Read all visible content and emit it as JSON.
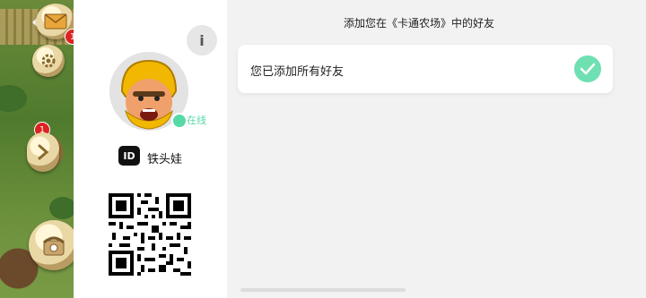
{
  "game_side": {
    "badges": [
      "1",
      "1"
    ]
  },
  "profile": {
    "info_label": "i",
    "online_label": "在线",
    "id_label": "ID",
    "username": "铁头娃",
    "colors": {
      "online": "#57d9a6",
      "accent": "#6ee0b2"
    }
  },
  "friends": {
    "title": "添加您在《卡通农场》中的好友",
    "status_text": "您已添加所有好友"
  }
}
